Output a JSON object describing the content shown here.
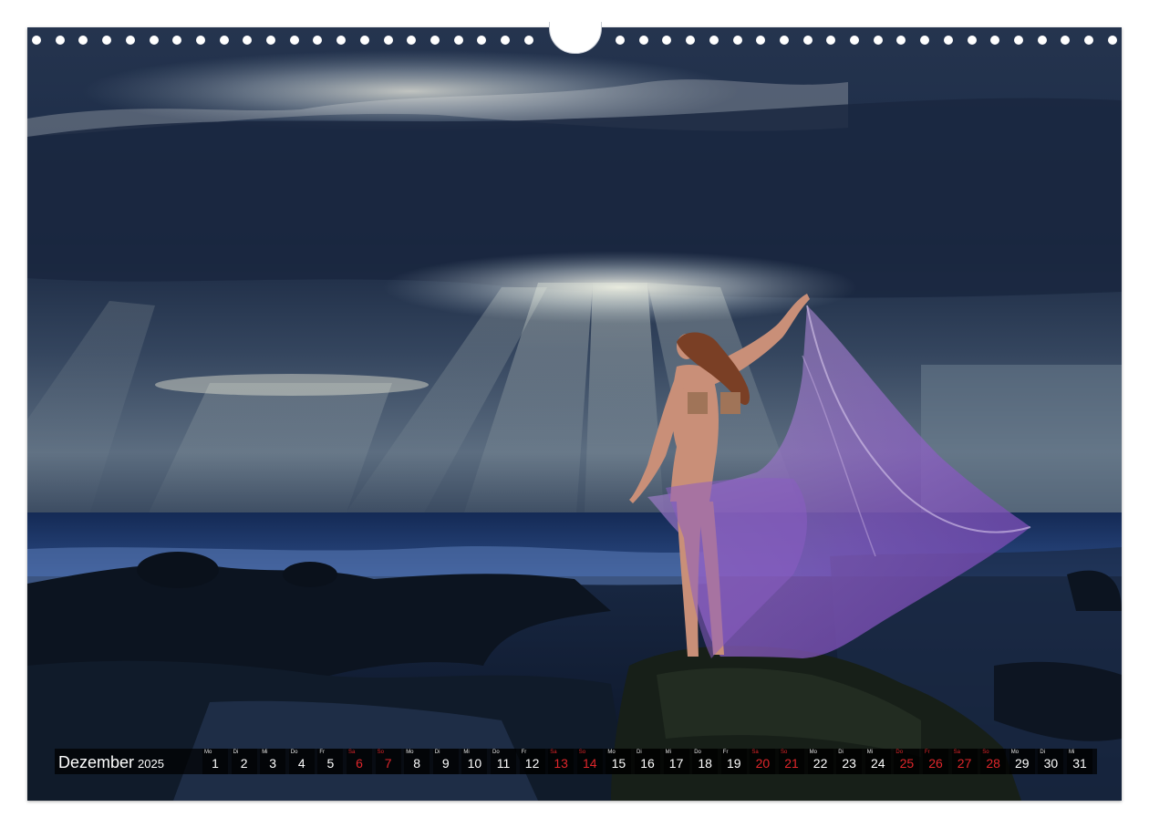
{
  "calendar": {
    "month": "Dezember",
    "year": "2025",
    "days": [
      {
        "wd": "Mo",
        "d": "1",
        "weekend": false
      },
      {
        "wd": "Di",
        "d": "2",
        "weekend": false
      },
      {
        "wd": "Mi",
        "d": "3",
        "weekend": false
      },
      {
        "wd": "Do",
        "d": "4",
        "weekend": false
      },
      {
        "wd": "Fr",
        "d": "5",
        "weekend": false
      },
      {
        "wd": "Sa",
        "d": "6",
        "weekend": true
      },
      {
        "wd": "So",
        "d": "7",
        "weekend": true
      },
      {
        "wd": "Mo",
        "d": "8",
        "weekend": false
      },
      {
        "wd": "Di",
        "d": "9",
        "weekend": false
      },
      {
        "wd": "Mi",
        "d": "10",
        "weekend": false
      },
      {
        "wd": "Do",
        "d": "11",
        "weekend": false
      },
      {
        "wd": "Fr",
        "d": "12",
        "weekend": false
      },
      {
        "wd": "Sa",
        "d": "13",
        "weekend": true
      },
      {
        "wd": "So",
        "d": "14",
        "weekend": true
      },
      {
        "wd": "Mo",
        "d": "15",
        "weekend": false
      },
      {
        "wd": "Di",
        "d": "16",
        "weekend": false
      },
      {
        "wd": "Mi",
        "d": "17",
        "weekend": false
      },
      {
        "wd": "Do",
        "d": "18",
        "weekend": false
      },
      {
        "wd": "Fr",
        "d": "19",
        "weekend": false
      },
      {
        "wd": "Sa",
        "d": "20",
        "weekend": true
      },
      {
        "wd": "So",
        "d": "21",
        "weekend": true
      },
      {
        "wd": "Mo",
        "d": "22",
        "weekend": false
      },
      {
        "wd": "Di",
        "d": "23",
        "weekend": false
      },
      {
        "wd": "Mi",
        "d": "24",
        "weekend": false
      },
      {
        "wd": "Do",
        "d": "25",
        "weekend": true
      },
      {
        "wd": "Fr",
        "d": "26",
        "weekend": true
      },
      {
        "wd": "Sa",
        "d": "27",
        "weekend": true
      },
      {
        "wd": "So",
        "d": "28",
        "weekend": true
      },
      {
        "wd": "Mo",
        "d": "29",
        "weekend": false
      },
      {
        "wd": "Di",
        "d": "30",
        "weekend": false
      },
      {
        "wd": "Mi",
        "d": "31",
        "weekend": false
      }
    ]
  },
  "colors": {
    "weekend": "#e0262b",
    "strip": "#000000",
    "fabric": "#8a5cc2"
  }
}
